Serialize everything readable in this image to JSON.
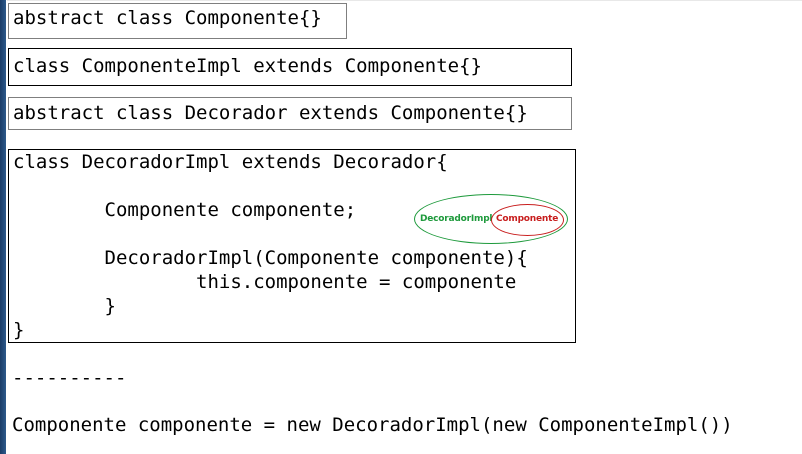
{
  "code": {
    "box1_line": "abstract class Componente{}",
    "box2_line": "class ComponenteImpl extends Componente{}",
    "box3_line": "abstract class Decorador extends Componente{}",
    "box4_lines": [
      "class DecoradorImpl extends Decorador{",
      "        Componente componente;",
      "        DecoradorImpl(Componente componente){",
      "                this.componente = componente",
      "        }",
      "}"
    ],
    "separator": "----------",
    "usage": "Componente componente = new DecoradorImpl(new ComponenteImpl())"
  },
  "diagram": {
    "outer_label": "DecoradorImpl",
    "inner_label": "Componente",
    "outer_color": "#1e9a3c",
    "inner_color": "#c81e1e"
  }
}
